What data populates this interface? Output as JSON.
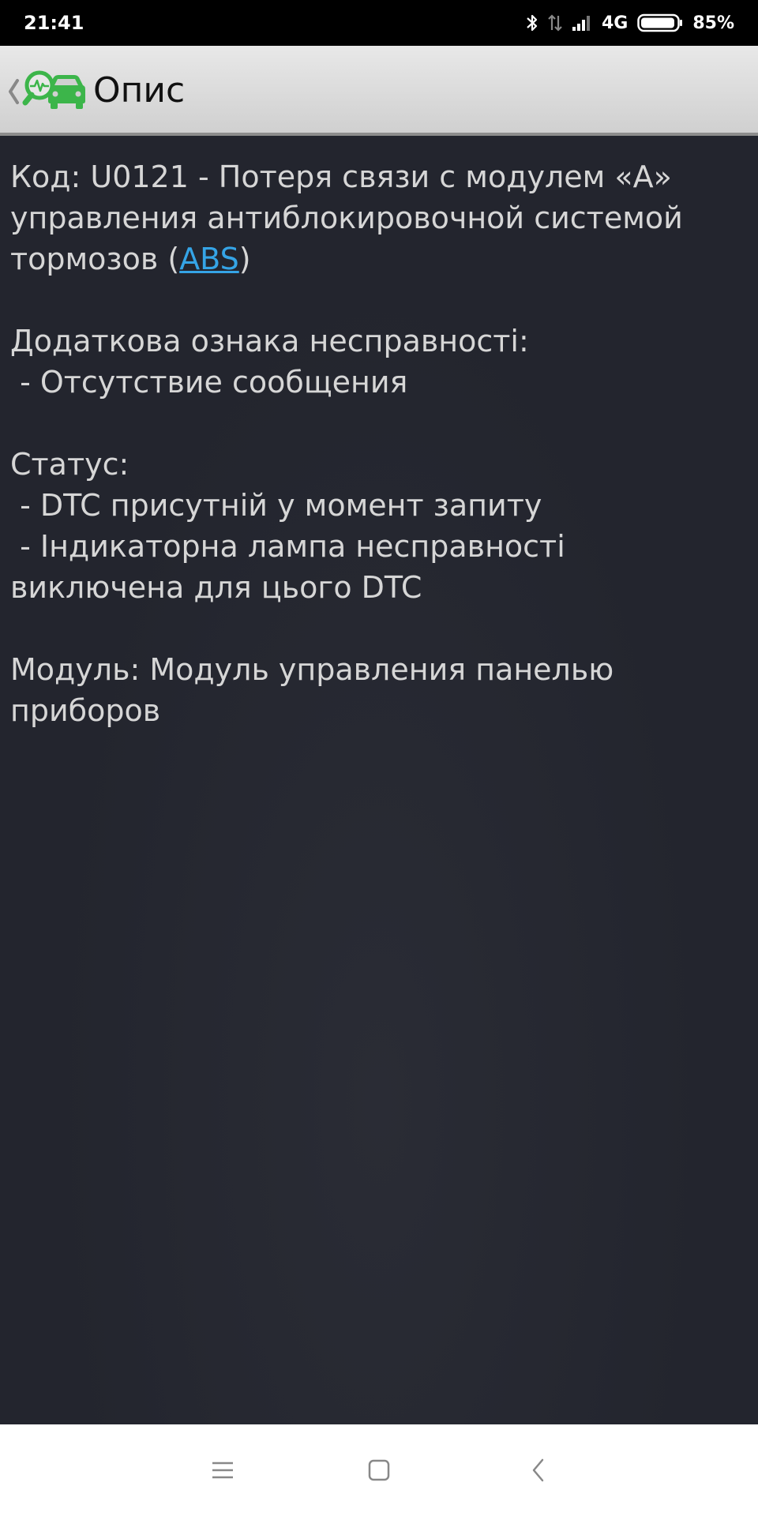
{
  "status_bar": {
    "time": "21:41",
    "network": "4G",
    "battery": "85%",
    "icons": [
      "bluetooth-icon",
      "data-transfer-icon",
      "signal-icon",
      "battery-icon"
    ]
  },
  "action_bar": {
    "title": "Опис",
    "icons": [
      "back-chevron-icon",
      "car-diagnostic-icon"
    ]
  },
  "description": {
    "code_prefix": "Код: U0121 - Потеря связи с модулем «A» управления антиблокировочной системой тормозов (",
    "code_link": "ABS",
    "code_suffix": ")",
    "extra_heading": "Додаткова ознака несправності:",
    "extra_item": " - Отсутствие сообщения",
    "status_heading": "Статус:",
    "status_item_1": " - DTC присутній у момент запиту",
    "status_item_2": " - Індикаторна лампа несправності виключена для цього DTC",
    "module": "Модуль: Модуль управления панелью приборов"
  },
  "nav_bar": {
    "icons": [
      "menu-icon",
      "home-icon",
      "back-icon"
    ]
  },
  "colors": {
    "background": "#23252e",
    "text": "#d6d6d6",
    "link": "#35a4e6",
    "app_green": "#3cb54a"
  }
}
